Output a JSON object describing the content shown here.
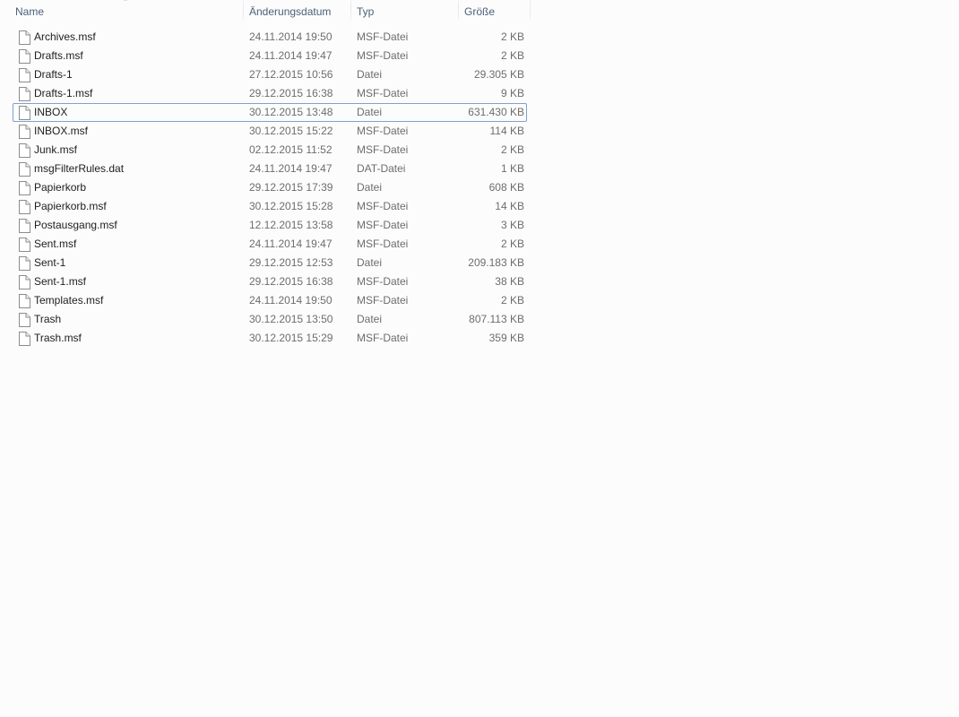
{
  "columns": {
    "name": "Name",
    "date": "Änderungsdatum",
    "type": "Typ",
    "size": "Größe"
  },
  "sort": {
    "column": "name",
    "direction": "ascending",
    "icon": "sort-up-arrow-icon"
  },
  "focused_row": 4,
  "files": [
    {
      "name": "Archives.msf",
      "date": "24.11.2014 19:50",
      "type": "MSF-Datei",
      "size": "2 KB",
      "icon": "file-icon"
    },
    {
      "name": "Drafts.msf",
      "date": "24.11.2014 19:47",
      "type": "MSF-Datei",
      "size": "2 KB",
      "icon": "file-icon"
    },
    {
      "name": "Drafts-1",
      "date": "27.12.2015 10:56",
      "type": "Datei",
      "size": "29.305 KB",
      "icon": "file-icon"
    },
    {
      "name": "Drafts-1.msf",
      "date": "29.12.2015 16:38",
      "type": "MSF-Datei",
      "size": "9 KB",
      "icon": "file-icon"
    },
    {
      "name": "INBOX",
      "date": "30.12.2015 13:48",
      "type": "Datei",
      "size": "631.430 KB",
      "icon": "file-icon"
    },
    {
      "name": "INBOX.msf",
      "date": "30.12.2015 15:22",
      "type": "MSF-Datei",
      "size": "114 KB",
      "icon": "file-icon"
    },
    {
      "name": "Junk.msf",
      "date": "02.12.2015 11:52",
      "type": "MSF-Datei",
      "size": "2 KB",
      "icon": "file-icon"
    },
    {
      "name": "msgFilterRules.dat",
      "date": "24.11.2014 19:47",
      "type": "DAT-Datei",
      "size": "1 KB",
      "icon": "file-icon"
    },
    {
      "name": "Papierkorb",
      "date": "29.12.2015 17:39",
      "type": "Datei",
      "size": "608 KB",
      "icon": "file-icon"
    },
    {
      "name": "Papierkorb.msf",
      "date": "30.12.2015 15:28",
      "type": "MSF-Datei",
      "size": "14 KB",
      "icon": "file-icon"
    },
    {
      "name": "Postausgang.msf",
      "date": "12.12.2015 13:58",
      "type": "MSF-Datei",
      "size": "3 KB",
      "icon": "file-icon"
    },
    {
      "name": "Sent.msf",
      "date": "24.11.2014 19:47",
      "type": "MSF-Datei",
      "size": "2 KB",
      "icon": "file-icon"
    },
    {
      "name": "Sent-1",
      "date": "29.12.2015 12:53",
      "type": "Datei",
      "size": "209.183 KB",
      "icon": "file-icon"
    },
    {
      "name": "Sent-1.msf",
      "date": "29.12.2015 16:38",
      "type": "MSF-Datei",
      "size": "38 KB",
      "icon": "file-icon"
    },
    {
      "name": "Templates.msf",
      "date": "24.11.2014 19:50",
      "type": "MSF-Datei",
      "size": "2 KB",
      "icon": "file-icon"
    },
    {
      "name": "Trash",
      "date": "30.12.2015 13:50",
      "type": "Datei",
      "size": "807.113 KB",
      "icon": "file-icon"
    },
    {
      "name": "Trash.msf",
      "date": "30.12.2015 15:29",
      "type": "MSF-Datei",
      "size": "359 KB",
      "icon": "file-icon"
    }
  ],
  "colors": {
    "header_text": "#4c607a",
    "focus_border": "#7da2ce",
    "secondary_text": "#6d6d6d",
    "background": "#fcfcfc"
  }
}
